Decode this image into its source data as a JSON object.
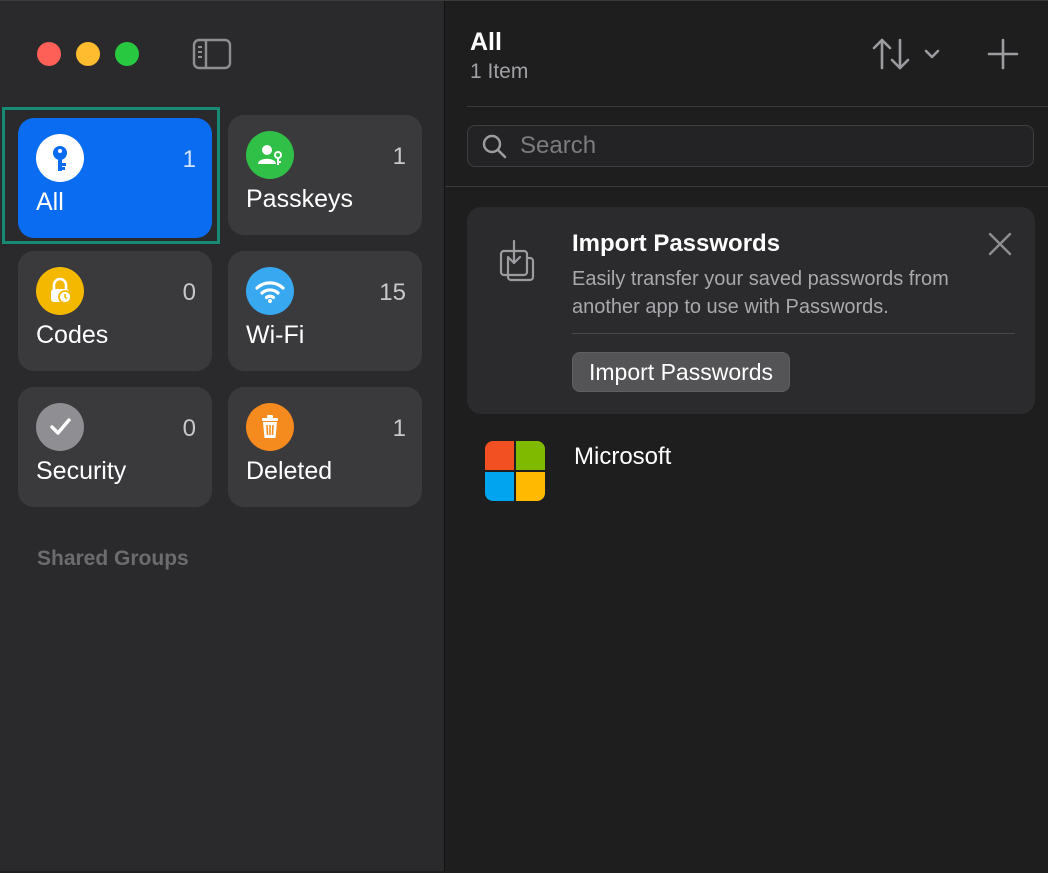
{
  "sidebar": {
    "tiles": [
      {
        "label": "All",
        "count": "1",
        "icon": "key-icon",
        "color": "#0a6cf0",
        "selected": true
      },
      {
        "label": "Passkeys",
        "count": "1",
        "icon": "passkey-person-icon",
        "color": "#30c048"
      },
      {
        "label": "Codes",
        "count": "0",
        "icon": "lock-clock-icon",
        "color": "#f5b800"
      },
      {
        "label": "Wi-Fi",
        "count": "15",
        "icon": "wifi-icon",
        "color": "#38a8f0"
      },
      {
        "label": "Security",
        "count": "0",
        "icon": "checkmark-icon",
        "color": "#8e8e93"
      },
      {
        "label": "Deleted",
        "count": "1",
        "icon": "trash-icon",
        "color": "#f58a1e"
      }
    ],
    "shared_groups_label": "Shared Groups"
  },
  "header": {
    "title": "All",
    "subtitle": "1 Item"
  },
  "search": {
    "placeholder": "Search"
  },
  "import_card": {
    "heading": "Import Passwords",
    "body": "Easily transfer your saved passwords from another app to use with Passwords.",
    "button_label": "Import Passwords"
  },
  "items": [
    {
      "name": "Microsoft",
      "logo": "microsoft-logo"
    }
  ],
  "colors": {
    "accent": "#0a6cf0",
    "focus_ring": "#178a74",
    "sidebar_bg": "#2a2a2c",
    "main_bg": "#1e1e1e"
  }
}
